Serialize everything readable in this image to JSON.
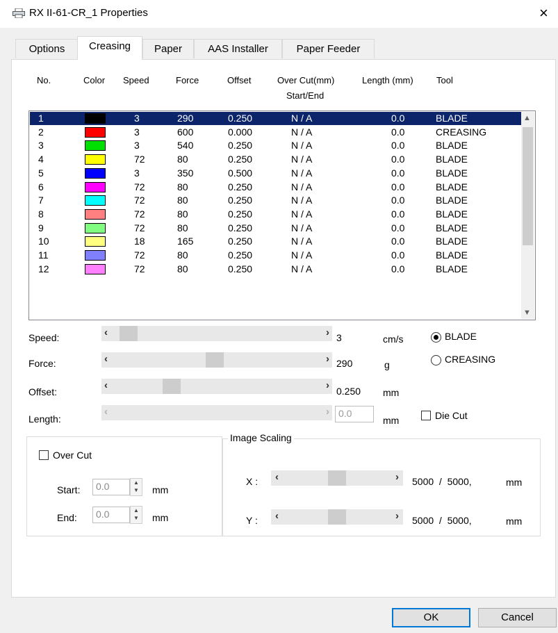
{
  "window": {
    "title": "RX II-61-CR_1 Properties",
    "close": "×"
  },
  "tabs": [
    "Options",
    "Creasing",
    "Paper",
    "AAS Installer",
    "Paper Feeder"
  ],
  "list": {
    "headers": {
      "no": "No.",
      "color": "Color",
      "speed": "Speed",
      "force": "Force",
      "offset": "Offset",
      "overcut1": "Over Cut(mm)",
      "overcut2": "Start/End",
      "length": "Length (mm)",
      "tool": "Tool"
    },
    "rows": [
      {
        "no": "1",
        "color": "#000000",
        "speed": "3",
        "force": "290",
        "offset": "0.250",
        "overcut": "N / A",
        "length": "0.0",
        "tool": "BLADE"
      },
      {
        "no": "2",
        "color": "#ff0000",
        "speed": "3",
        "force": "600",
        "offset": "0.000",
        "overcut": "N / A",
        "length": "0.0",
        "tool": "CREASING"
      },
      {
        "no": "3",
        "color": "#00e000",
        "speed": "3",
        "force": "540",
        "offset": "0.250",
        "overcut": "N / A",
        "length": "0.0",
        "tool": "BLADE"
      },
      {
        "no": "4",
        "color": "#ffff00",
        "speed": "72",
        "force": "80",
        "offset": "0.250",
        "overcut": "N / A",
        "length": "0.0",
        "tool": "BLADE"
      },
      {
        "no": "5",
        "color": "#0000ff",
        "speed": "3",
        "force": "350",
        "offset": "0.500",
        "overcut": "N / A",
        "length": "0.0",
        "tool": "BLADE"
      },
      {
        "no": "6",
        "color": "#ff00ff",
        "speed": "72",
        "force": "80",
        "offset": "0.250",
        "overcut": "N / A",
        "length": "0.0",
        "tool": "BLADE"
      },
      {
        "no": "7",
        "color": "#00ffff",
        "speed": "72",
        "force": "80",
        "offset": "0.250",
        "overcut": "N / A",
        "length": "0.0",
        "tool": "BLADE"
      },
      {
        "no": "8",
        "color": "#ff8080",
        "speed": "72",
        "force": "80",
        "offset": "0.250",
        "overcut": "N / A",
        "length": "0.0",
        "tool": "BLADE"
      },
      {
        "no": "9",
        "color": "#80ff80",
        "speed": "72",
        "force": "80",
        "offset": "0.250",
        "overcut": "N / A",
        "length": "0.0",
        "tool": "BLADE"
      },
      {
        "no": "10",
        "color": "#ffff80",
        "speed": "18",
        "force": "165",
        "offset": "0.250",
        "overcut": "N / A",
        "length": "0.0",
        "tool": "BLADE"
      },
      {
        "no": "11",
        "color": "#8080ff",
        "speed": "72",
        "force": "80",
        "offset": "0.250",
        "overcut": "N / A",
        "length": "0.0",
        "tool": "BLADE"
      },
      {
        "no": "12",
        "color": "#ff80ff",
        "speed": "72",
        "force": "80",
        "offset": "0.250",
        "overcut": "N / A",
        "length": "0.0",
        "tool": "BLADE"
      }
    ],
    "selected_index": 0
  },
  "params": {
    "speed": {
      "label": "Speed:",
      "value": "3",
      "unit": "cm/s"
    },
    "force": {
      "label": "Force:",
      "value": "290",
      "unit": "g"
    },
    "offset": {
      "label": "Offset:",
      "value": "0.250",
      "unit": "mm"
    },
    "length": {
      "label": "Length:",
      "value": "0.0",
      "unit": "mm"
    }
  },
  "tool": {
    "blade": "BLADE",
    "creasing": "CREASING",
    "selected": "BLADE"
  },
  "die_cut": {
    "label": "Die Cut",
    "checked": false
  },
  "over_cut": {
    "label": "Over Cut",
    "checked": false,
    "start_label": "Start:",
    "start_value": "0.0",
    "end_label": "End:",
    "end_value": "0.0",
    "unit": "mm"
  },
  "image_scaling": {
    "label": "Image Scaling",
    "x_label": "X :",
    "x_value": "5000  /  5000,",
    "x_unit": "mm",
    "y_label": "Y :",
    "y_value": "5000  /  5000,",
    "y_unit": "mm"
  },
  "buttons": {
    "ok": "OK",
    "cancel": "Cancel"
  }
}
